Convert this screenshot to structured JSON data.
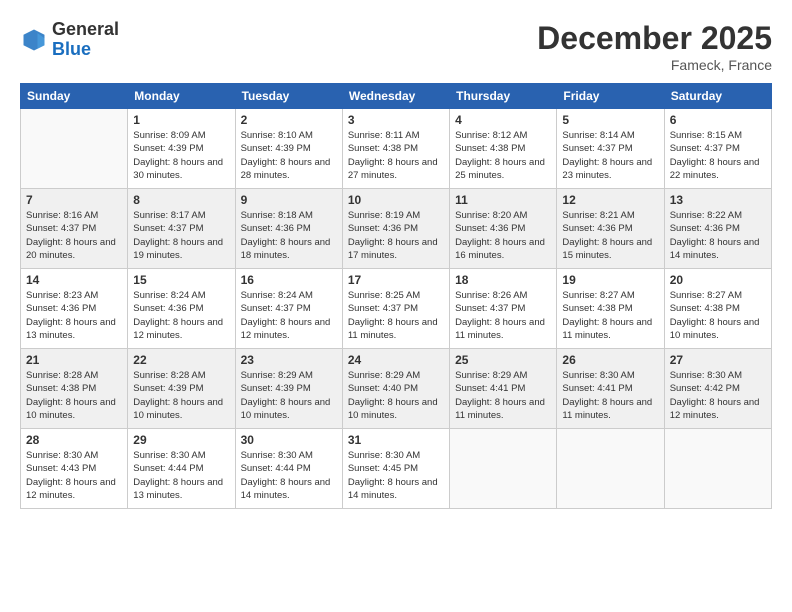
{
  "header": {
    "logo_general": "General",
    "logo_blue": "Blue",
    "month_title": "December 2025",
    "location": "Fameck, France"
  },
  "weekdays": [
    "Sunday",
    "Monday",
    "Tuesday",
    "Wednesday",
    "Thursday",
    "Friday",
    "Saturday"
  ],
  "weeks": [
    [
      {
        "day": "",
        "empty": true
      },
      {
        "day": "1",
        "sunrise": "8:09 AM",
        "sunset": "4:39 PM",
        "daylight": "8 hours and 30 minutes."
      },
      {
        "day": "2",
        "sunrise": "8:10 AM",
        "sunset": "4:39 PM",
        "daylight": "8 hours and 28 minutes."
      },
      {
        "day": "3",
        "sunrise": "8:11 AM",
        "sunset": "4:38 PM",
        "daylight": "8 hours and 27 minutes."
      },
      {
        "day": "4",
        "sunrise": "8:12 AM",
        "sunset": "4:38 PM",
        "daylight": "8 hours and 25 minutes."
      },
      {
        "day": "5",
        "sunrise": "8:14 AM",
        "sunset": "4:37 PM",
        "daylight": "8 hours and 23 minutes."
      },
      {
        "day": "6",
        "sunrise": "8:15 AM",
        "sunset": "4:37 PM",
        "daylight": "8 hours and 22 minutes."
      }
    ],
    [
      {
        "day": "7",
        "sunrise": "8:16 AM",
        "sunset": "4:37 PM",
        "daylight": "8 hours and 20 minutes."
      },
      {
        "day": "8",
        "sunrise": "8:17 AM",
        "sunset": "4:37 PM",
        "daylight": "8 hours and 19 minutes."
      },
      {
        "day": "9",
        "sunrise": "8:18 AM",
        "sunset": "4:36 PM",
        "daylight": "8 hours and 18 minutes."
      },
      {
        "day": "10",
        "sunrise": "8:19 AM",
        "sunset": "4:36 PM",
        "daylight": "8 hours and 17 minutes."
      },
      {
        "day": "11",
        "sunrise": "8:20 AM",
        "sunset": "4:36 PM",
        "daylight": "8 hours and 16 minutes."
      },
      {
        "day": "12",
        "sunrise": "8:21 AM",
        "sunset": "4:36 PM",
        "daylight": "8 hours and 15 minutes."
      },
      {
        "day": "13",
        "sunrise": "8:22 AM",
        "sunset": "4:36 PM",
        "daylight": "8 hours and 14 minutes."
      }
    ],
    [
      {
        "day": "14",
        "sunrise": "8:23 AM",
        "sunset": "4:36 PM",
        "daylight": "8 hours and 13 minutes."
      },
      {
        "day": "15",
        "sunrise": "8:24 AM",
        "sunset": "4:36 PM",
        "daylight": "8 hours and 12 minutes."
      },
      {
        "day": "16",
        "sunrise": "8:24 AM",
        "sunset": "4:37 PM",
        "daylight": "8 hours and 12 minutes."
      },
      {
        "day": "17",
        "sunrise": "8:25 AM",
        "sunset": "4:37 PM",
        "daylight": "8 hours and 11 minutes."
      },
      {
        "day": "18",
        "sunrise": "8:26 AM",
        "sunset": "4:37 PM",
        "daylight": "8 hours and 11 minutes."
      },
      {
        "day": "19",
        "sunrise": "8:27 AM",
        "sunset": "4:38 PM",
        "daylight": "8 hours and 11 minutes."
      },
      {
        "day": "20",
        "sunrise": "8:27 AM",
        "sunset": "4:38 PM",
        "daylight": "8 hours and 10 minutes."
      }
    ],
    [
      {
        "day": "21",
        "sunrise": "8:28 AM",
        "sunset": "4:38 PM",
        "daylight": "8 hours and 10 minutes."
      },
      {
        "day": "22",
        "sunrise": "8:28 AM",
        "sunset": "4:39 PM",
        "daylight": "8 hours and 10 minutes."
      },
      {
        "day": "23",
        "sunrise": "8:29 AM",
        "sunset": "4:39 PM",
        "daylight": "8 hours and 10 minutes."
      },
      {
        "day": "24",
        "sunrise": "8:29 AM",
        "sunset": "4:40 PM",
        "daylight": "8 hours and 10 minutes."
      },
      {
        "day": "25",
        "sunrise": "8:29 AM",
        "sunset": "4:41 PM",
        "daylight": "8 hours and 11 minutes."
      },
      {
        "day": "26",
        "sunrise": "8:30 AM",
        "sunset": "4:41 PM",
        "daylight": "8 hours and 11 minutes."
      },
      {
        "day": "27",
        "sunrise": "8:30 AM",
        "sunset": "4:42 PM",
        "daylight": "8 hours and 12 minutes."
      }
    ],
    [
      {
        "day": "28",
        "sunrise": "8:30 AM",
        "sunset": "4:43 PM",
        "daylight": "8 hours and 12 minutes."
      },
      {
        "day": "29",
        "sunrise": "8:30 AM",
        "sunset": "4:44 PM",
        "daylight": "8 hours and 13 minutes."
      },
      {
        "day": "30",
        "sunrise": "8:30 AM",
        "sunset": "4:44 PM",
        "daylight": "8 hours and 14 minutes."
      },
      {
        "day": "31",
        "sunrise": "8:30 AM",
        "sunset": "4:45 PM",
        "daylight": "8 hours and 14 minutes."
      },
      {
        "day": "",
        "empty": true
      },
      {
        "day": "",
        "empty": true
      },
      {
        "day": "",
        "empty": true
      }
    ]
  ]
}
